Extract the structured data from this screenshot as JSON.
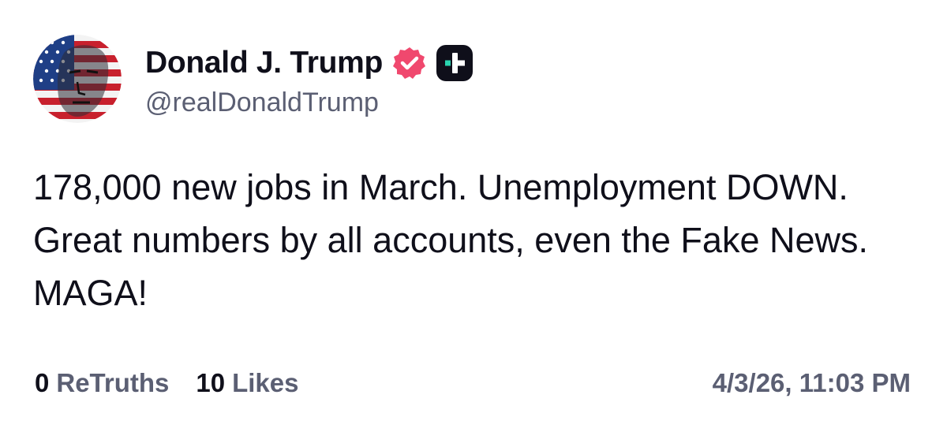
{
  "post": {
    "author": {
      "display_name": "Donald J. Trump",
      "handle": "@realDonaldTrump",
      "verified_icon": "verified-badge-icon",
      "extra_badge_icon": "truth-plus-icon",
      "avatar_icon": "profile-avatar"
    },
    "body_text": "178,000 new jobs in March. Unemployment DOWN. Great numbers by all accounts, even the Fake News. MAGA!",
    "stats": {
      "retruths_count": "0",
      "retruths_label": "ReTruths",
      "likes_count": "10",
      "likes_label": "Likes"
    },
    "timestamp": "4/3/26, 11:03 PM"
  },
  "colors": {
    "primary_text": "#0f0f1a",
    "secondary_text": "#5b5f73",
    "verified_badge": "#f0486e",
    "plus_badge_bg": "#0f0f1a",
    "plus_badge_accent": "#2ad4b0",
    "background": "#ffffff"
  }
}
